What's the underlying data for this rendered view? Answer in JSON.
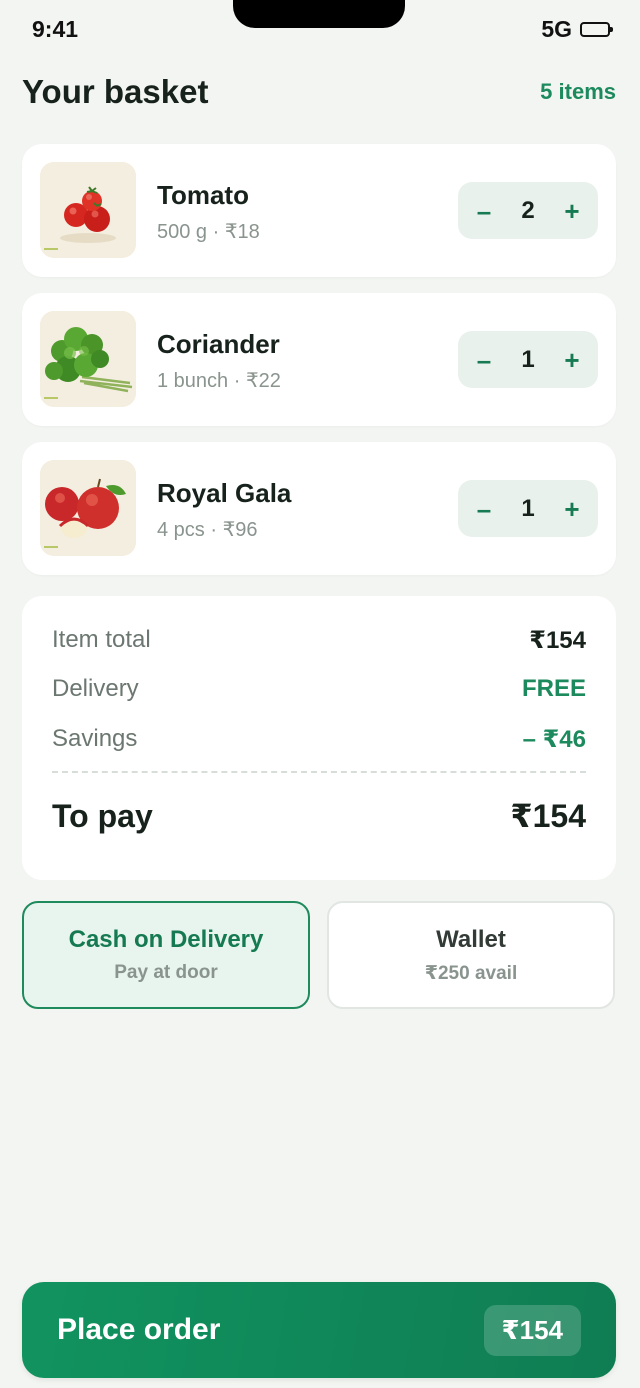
{
  "status_bar": {
    "time": "9:41",
    "network": "5G"
  },
  "header": {
    "title": "Your basket",
    "item_count": "5 items"
  },
  "items": [
    {
      "name": "Tomato",
      "meta": "500 g · ₹18",
      "qty": "2",
      "minus": "–",
      "plus": "+",
      "image": "tomato-image"
    },
    {
      "name": "Coriander",
      "meta": "1 bunch · ₹22",
      "qty": "1",
      "minus": "–",
      "plus": "+",
      "image": "coriander-image"
    },
    {
      "name": "Royal Gala",
      "meta": "4 pcs · ₹96",
      "qty": "1",
      "minus": "–",
      "plus": "+",
      "image": "apple-image"
    }
  ],
  "summary": {
    "item_total_label": "Item total",
    "item_total_value": "₹154",
    "delivery_label": "Delivery",
    "delivery_value": "FREE",
    "savings_label": "Savings",
    "savings_value": "– ₹46",
    "to_pay_label": "To pay",
    "to_pay_value": "₹154"
  },
  "payment": {
    "cod": {
      "title": "Cash on Delivery",
      "subtitle": "Pay at door",
      "selected": true
    },
    "wallet": {
      "title": "Wallet",
      "subtitle": "₹250 avail",
      "selected": false
    }
  },
  "cta": {
    "label": "Place order",
    "amount": "₹154"
  },
  "colors": {
    "accent": "#1c8a5c",
    "background": "#f3f5f2",
    "card": "#ffffff",
    "stepper": "#e9f1ec"
  }
}
